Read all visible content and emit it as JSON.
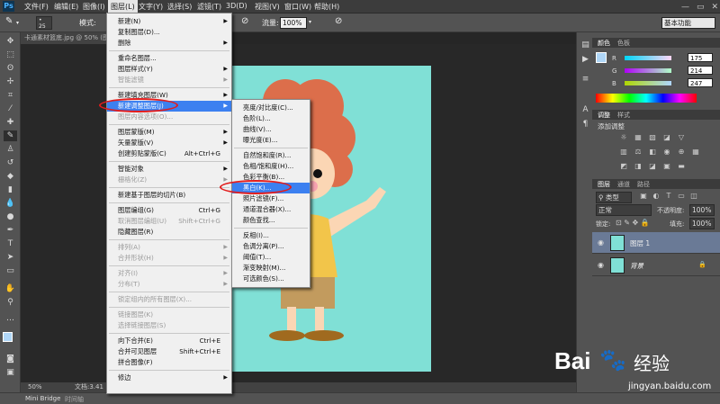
{
  "menubar": {
    "logo": "Ps",
    "items": [
      "文件(F)",
      "编辑(E)",
      "图像(I)",
      "图层(L)",
      "文字(Y)",
      "选择(S)",
      "滤镜(T)",
      "3D(D)",
      "视图(V)",
      "窗口(W)",
      "帮助(H)"
    ],
    "window_buttons": [
      "—",
      "▭",
      "✕"
    ]
  },
  "options": {
    "size": "25",
    "mode_label": "模式:",
    "flow_label": "流量:",
    "flow_value": "100%",
    "workspace": "基本功能"
  },
  "document": {
    "tab_title": "卡通素材篮底.jpg @ 50% (图",
    "zoom": "50%",
    "status": "文档:3.41"
  },
  "bottom": {
    "mini_bridge": "Mini Bridge",
    "timeline": "时间轴"
  },
  "layer_menu": {
    "items": [
      {
        "label": "新建(N)",
        "arrow": true
      },
      {
        "label": "复制图层(D)..."
      },
      {
        "label": "删除",
        "arrow": true
      },
      {
        "sep": true
      },
      {
        "label": "重命名图层..."
      },
      {
        "label": "图层样式(Y)",
        "arrow": true
      },
      {
        "label": "智能滤镜",
        "arrow": true,
        "disabled": true
      },
      {
        "sep": true
      },
      {
        "label": "新建填充图层(W)",
        "arrow": true
      },
      {
        "label": "新建调整图层(J)",
        "arrow": true,
        "highlight": true
      },
      {
        "label": "图层内容选项(O)...",
        "disabled": true
      },
      {
        "sep": true
      },
      {
        "label": "图层蒙版(M)",
        "arrow": true
      },
      {
        "label": "矢量蒙版(V)",
        "arrow": true
      },
      {
        "label": "创建剪贴蒙版(C)",
        "shortcut": "Alt+Ctrl+G"
      },
      {
        "sep": true
      },
      {
        "label": "智能对象",
        "arrow": true
      },
      {
        "label": "栅格化(Z)",
        "arrow": true,
        "disabled": true
      },
      {
        "sep": true
      },
      {
        "label": "新建基于图层的切片(B)"
      },
      {
        "sep": true
      },
      {
        "label": "图层编组(G)",
        "shortcut": "Ctrl+G"
      },
      {
        "label": "取消图层编组(U)",
        "shortcut": "Shift+Ctrl+G",
        "disabled": true
      },
      {
        "label": "隐藏图层(R)"
      },
      {
        "sep": true
      },
      {
        "label": "排列(A)",
        "arrow": true,
        "disabled": true
      },
      {
        "label": "合并形状(H)",
        "arrow": true,
        "disabled": true
      },
      {
        "sep": true
      },
      {
        "label": "对齐(I)",
        "arrow": true,
        "disabled": true
      },
      {
        "label": "分布(T)",
        "arrow": true,
        "disabled": true
      },
      {
        "sep": true
      },
      {
        "label": "锁定组内的所有图层(X)...",
        "disabled": true
      },
      {
        "sep": true
      },
      {
        "label": "链接图层(K)",
        "disabled": true
      },
      {
        "label": "选择链接图层(S)",
        "disabled": true
      },
      {
        "sep": true
      },
      {
        "label": "向下合并(E)",
        "shortcut": "Ctrl+E"
      },
      {
        "label": "合并可见图层",
        "shortcut": "Shift+Ctrl+E"
      },
      {
        "label": "拼合图像(F)"
      },
      {
        "sep": true
      },
      {
        "label": "修边",
        "arrow": true
      }
    ]
  },
  "adjust_submenu": {
    "items": [
      {
        "label": "亮度/对比度(C)..."
      },
      {
        "label": "色阶(L)..."
      },
      {
        "label": "曲线(V)..."
      },
      {
        "label": "曝光度(E)..."
      },
      {
        "sep": true
      },
      {
        "label": "自然饱和度(R)..."
      },
      {
        "label": "色相/饱和度(H)..."
      },
      {
        "label": "色彩平衡(B)..."
      },
      {
        "label": "黑白(K)...",
        "highlight": true
      },
      {
        "label": "照片滤镜(F)..."
      },
      {
        "label": "通道混合器(X)..."
      },
      {
        "label": "颜色查找..."
      },
      {
        "sep": true
      },
      {
        "label": "反相(I)..."
      },
      {
        "label": "色调分离(P)..."
      },
      {
        "label": "阈值(T)..."
      },
      {
        "label": "渐变映射(M)..."
      },
      {
        "label": "可选颜色(S)..."
      }
    ]
  },
  "color_panel": {
    "tabs": [
      "颜色",
      "色板"
    ],
    "channels": [
      {
        "name": "R",
        "value": "175"
      },
      {
        "name": "G",
        "value": "214"
      },
      {
        "name": "B",
        "value": "247"
      }
    ],
    "foreground": "#afd6f7"
  },
  "adjust_panel": {
    "tabs": [
      "调整",
      "样式"
    ],
    "title": "添加调整"
  },
  "layers_panel": {
    "tabs": [
      "图层",
      "通道",
      "路径"
    ],
    "kind": "类型",
    "blend": "正常",
    "opacity_label": "不透明度:",
    "opacity": "100%",
    "lock_label": "锁定:",
    "fill_label": "填充:",
    "fill": "100%",
    "layers": [
      {
        "name": "图层 1",
        "selected": true
      },
      {
        "name": "背景",
        "locked": true
      }
    ]
  },
  "watermark": {
    "brand": "Bai",
    "brand2": "经验",
    "url": "jingyan.baidu.com"
  }
}
